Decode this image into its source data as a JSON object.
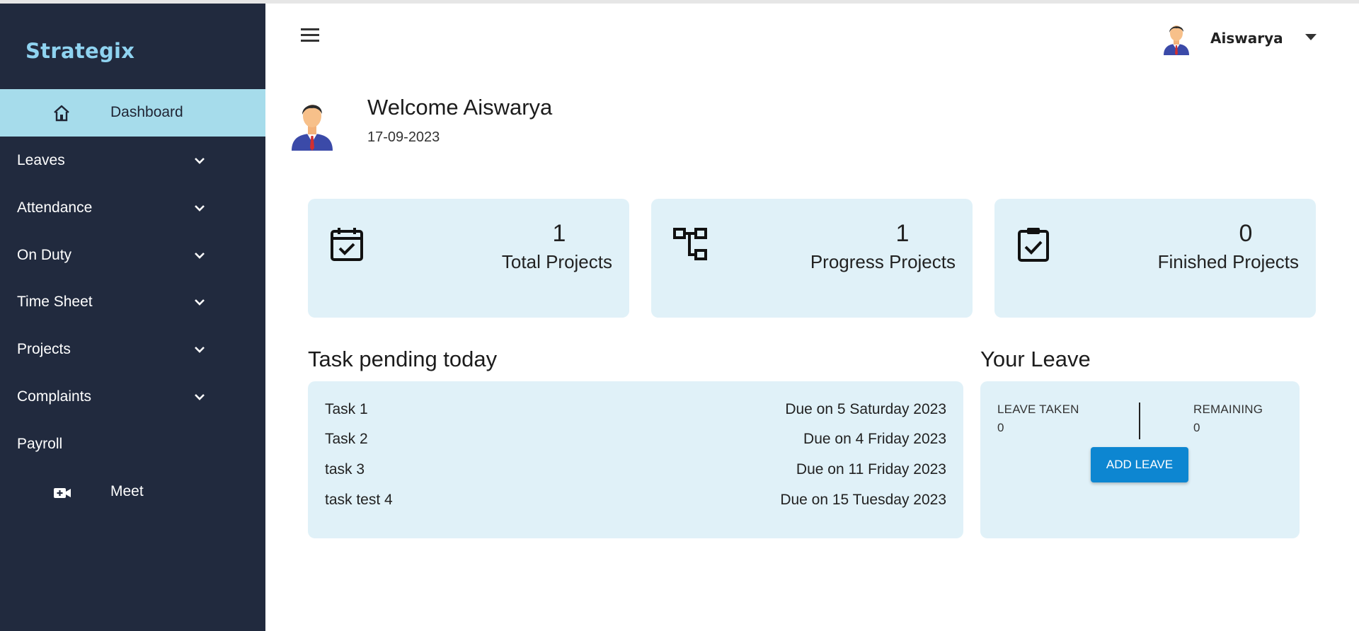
{
  "brand": "Strategix",
  "sidebar": {
    "active": {
      "label": "Dashboard",
      "icon": "home-icon"
    },
    "items": [
      {
        "label": "Leaves",
        "icon": "chevron-down-icon"
      },
      {
        "label": "Attendance",
        "icon": "chevron-down-icon"
      },
      {
        "label": "On Duty",
        "icon": "chevron-down-icon"
      },
      {
        "label": "Time Sheet",
        "icon": "chevron-down-icon"
      },
      {
        "label": "Projects",
        "icon": "chevron-down-icon"
      },
      {
        "label": "Complaints",
        "icon": "chevron-down-icon"
      },
      {
        "label": "Payroll"
      }
    ],
    "meet": {
      "label": "Meet",
      "icon": "video-add-icon"
    }
  },
  "header": {
    "menu_icon": "hamburger-icon",
    "user_name": "Aiswarya"
  },
  "welcome": {
    "title": "Welcome Aiswarya",
    "date": "17-09-2023"
  },
  "stats": [
    {
      "value": "1",
      "label": "Total Projects",
      "icon": "calendar-check-icon"
    },
    {
      "value": "1",
      "label": "Progress Projects",
      "icon": "hierarchy-icon"
    },
    {
      "value": "0",
      "label": "Finished Projects",
      "icon": "clipboard-check-icon"
    }
  ],
  "tasks": {
    "title": "Task pending today",
    "rows": [
      {
        "name": "Task 1",
        "due": "Due on 5 Saturday 2023"
      },
      {
        "name": "Task 2",
        "due": "Due on 4 Friday 2023"
      },
      {
        "name": "task 3",
        "due": "Due on 11 Friday 2023"
      },
      {
        "name": "task test 4",
        "due": "Due on 15 Tuesday 2023"
      }
    ]
  },
  "leave": {
    "title": "Your Leave",
    "taken_label": "LEAVE TAKEN",
    "taken_value": "0",
    "remaining_label": "REMAINING",
    "remaining_value": "0",
    "button": "ADD LEAVE"
  },
  "colors": {
    "sidebar_bg": "#212a3e",
    "active_bg": "#a6dceb",
    "brand": "#8fd3f0",
    "card_bg": "#e0f1f8",
    "button": "#0d86d1"
  }
}
